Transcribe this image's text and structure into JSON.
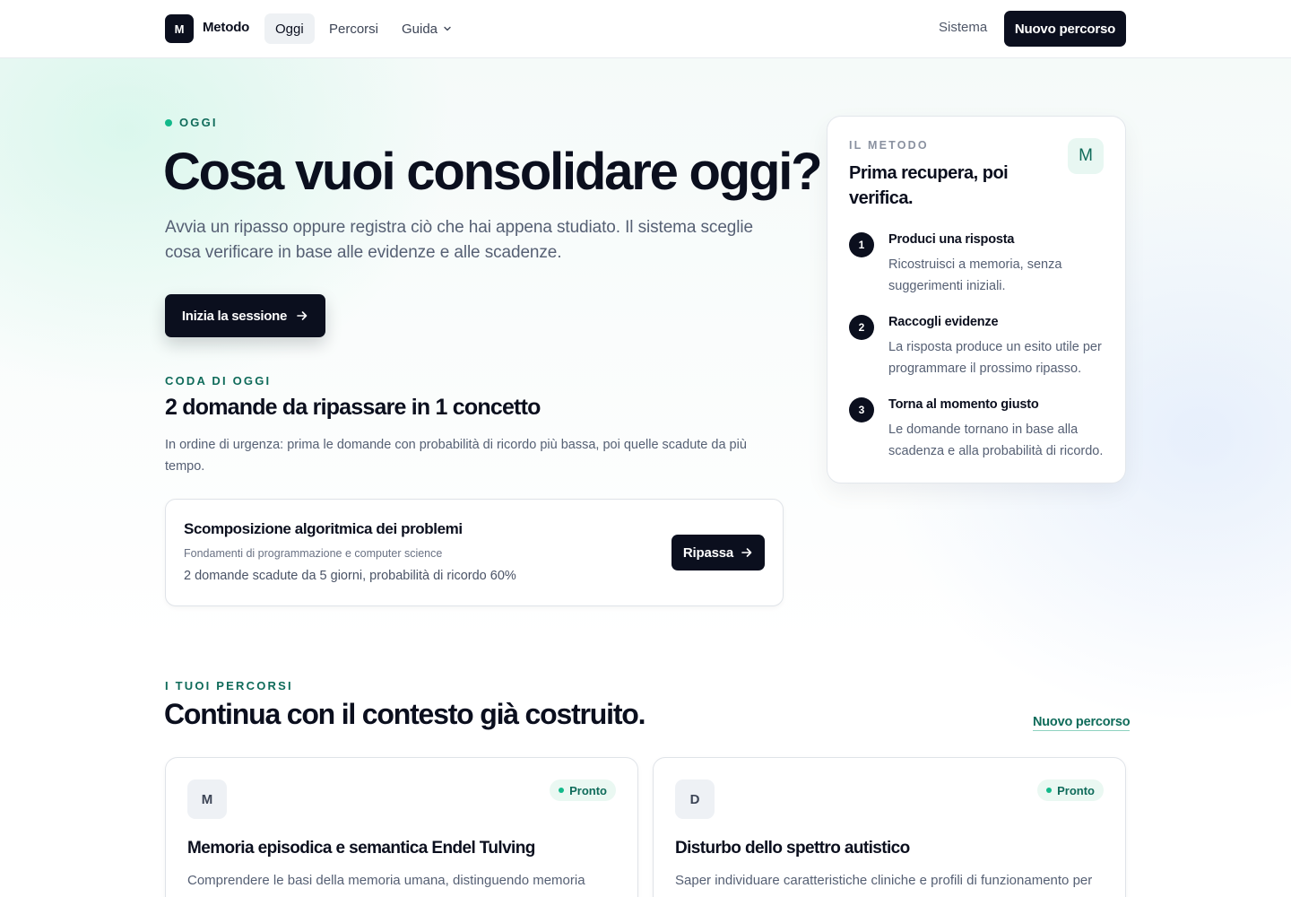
{
  "nav": {
    "logo_mark": "M",
    "logo_text": "Metodo",
    "links": [
      {
        "label": "Oggi",
        "active": true
      },
      {
        "label": "Percorsi",
        "active": false
      },
      {
        "label": "Guida",
        "active": false
      }
    ],
    "sistema": "Sistema",
    "cta": "Nuovo percorso"
  },
  "hero": {
    "eyebrow": "OGGI",
    "title": "Cosa vuoi consolidare oggi?",
    "subtitle": "Avvia un ripasso oppure registra ciò che hai appena studiato. Il sistema sceglie cosa verificare in base alle evidenze e alle scadenze.",
    "cta": "Inizia la sessione"
  },
  "queue": {
    "eyebrow": "CODA DI OGGI",
    "title": "2 domande da ripassare in 1 concetto",
    "description": "In ordine di urgenza: prima le domande con probabilità di ricordo più bassa, poi quelle scadute da più tempo.",
    "item": {
      "title": "Scomposizione algoritmica dei problemi",
      "subject": "Fondamenti di programmazione e computer science",
      "meta": "2 domande scadute da 5 giorni, probabilità di ricordo 60%",
      "button": "Ripassa"
    }
  },
  "method": {
    "eyebrow": "IL METODO",
    "title": "Prima recupera, poi verifica.",
    "badge": "M",
    "steps": [
      {
        "num": "1",
        "title": "Produci una risposta",
        "text": "Ricostruisci a memoria, senza suggerimenti iniziali."
      },
      {
        "num": "2",
        "title": "Raccogli evidenze",
        "text": "La risposta produce un esito utile per programmare il prossimo ripasso."
      },
      {
        "num": "3",
        "title": "Torna al momento giusto",
        "text": "Le domande tornano in base alla scadenza e alla probabilità di ricordo."
      }
    ]
  },
  "percorsi": {
    "eyebrow": "I TUOI PERCORSI",
    "title": "Continua con il contesto già costruito.",
    "link": "Nuovo percorso",
    "courses": [
      {
        "initial": "M",
        "status": "Pronto",
        "title": "Memoria episodica e semantica Endel Tulving",
        "description": "Comprendere le basi della memoria umana, distinguendo memoria"
      },
      {
        "initial": "D",
        "status": "Pronto",
        "title": "Disturbo dello spettro autistico",
        "description": "Saper individuare caratteristiche cliniche e profili di funzionamento per"
      }
    ]
  },
  "colors": {
    "ink": "#0b0f1e",
    "accent": "#0f6b5a",
    "status_dot": "#12b98a"
  }
}
